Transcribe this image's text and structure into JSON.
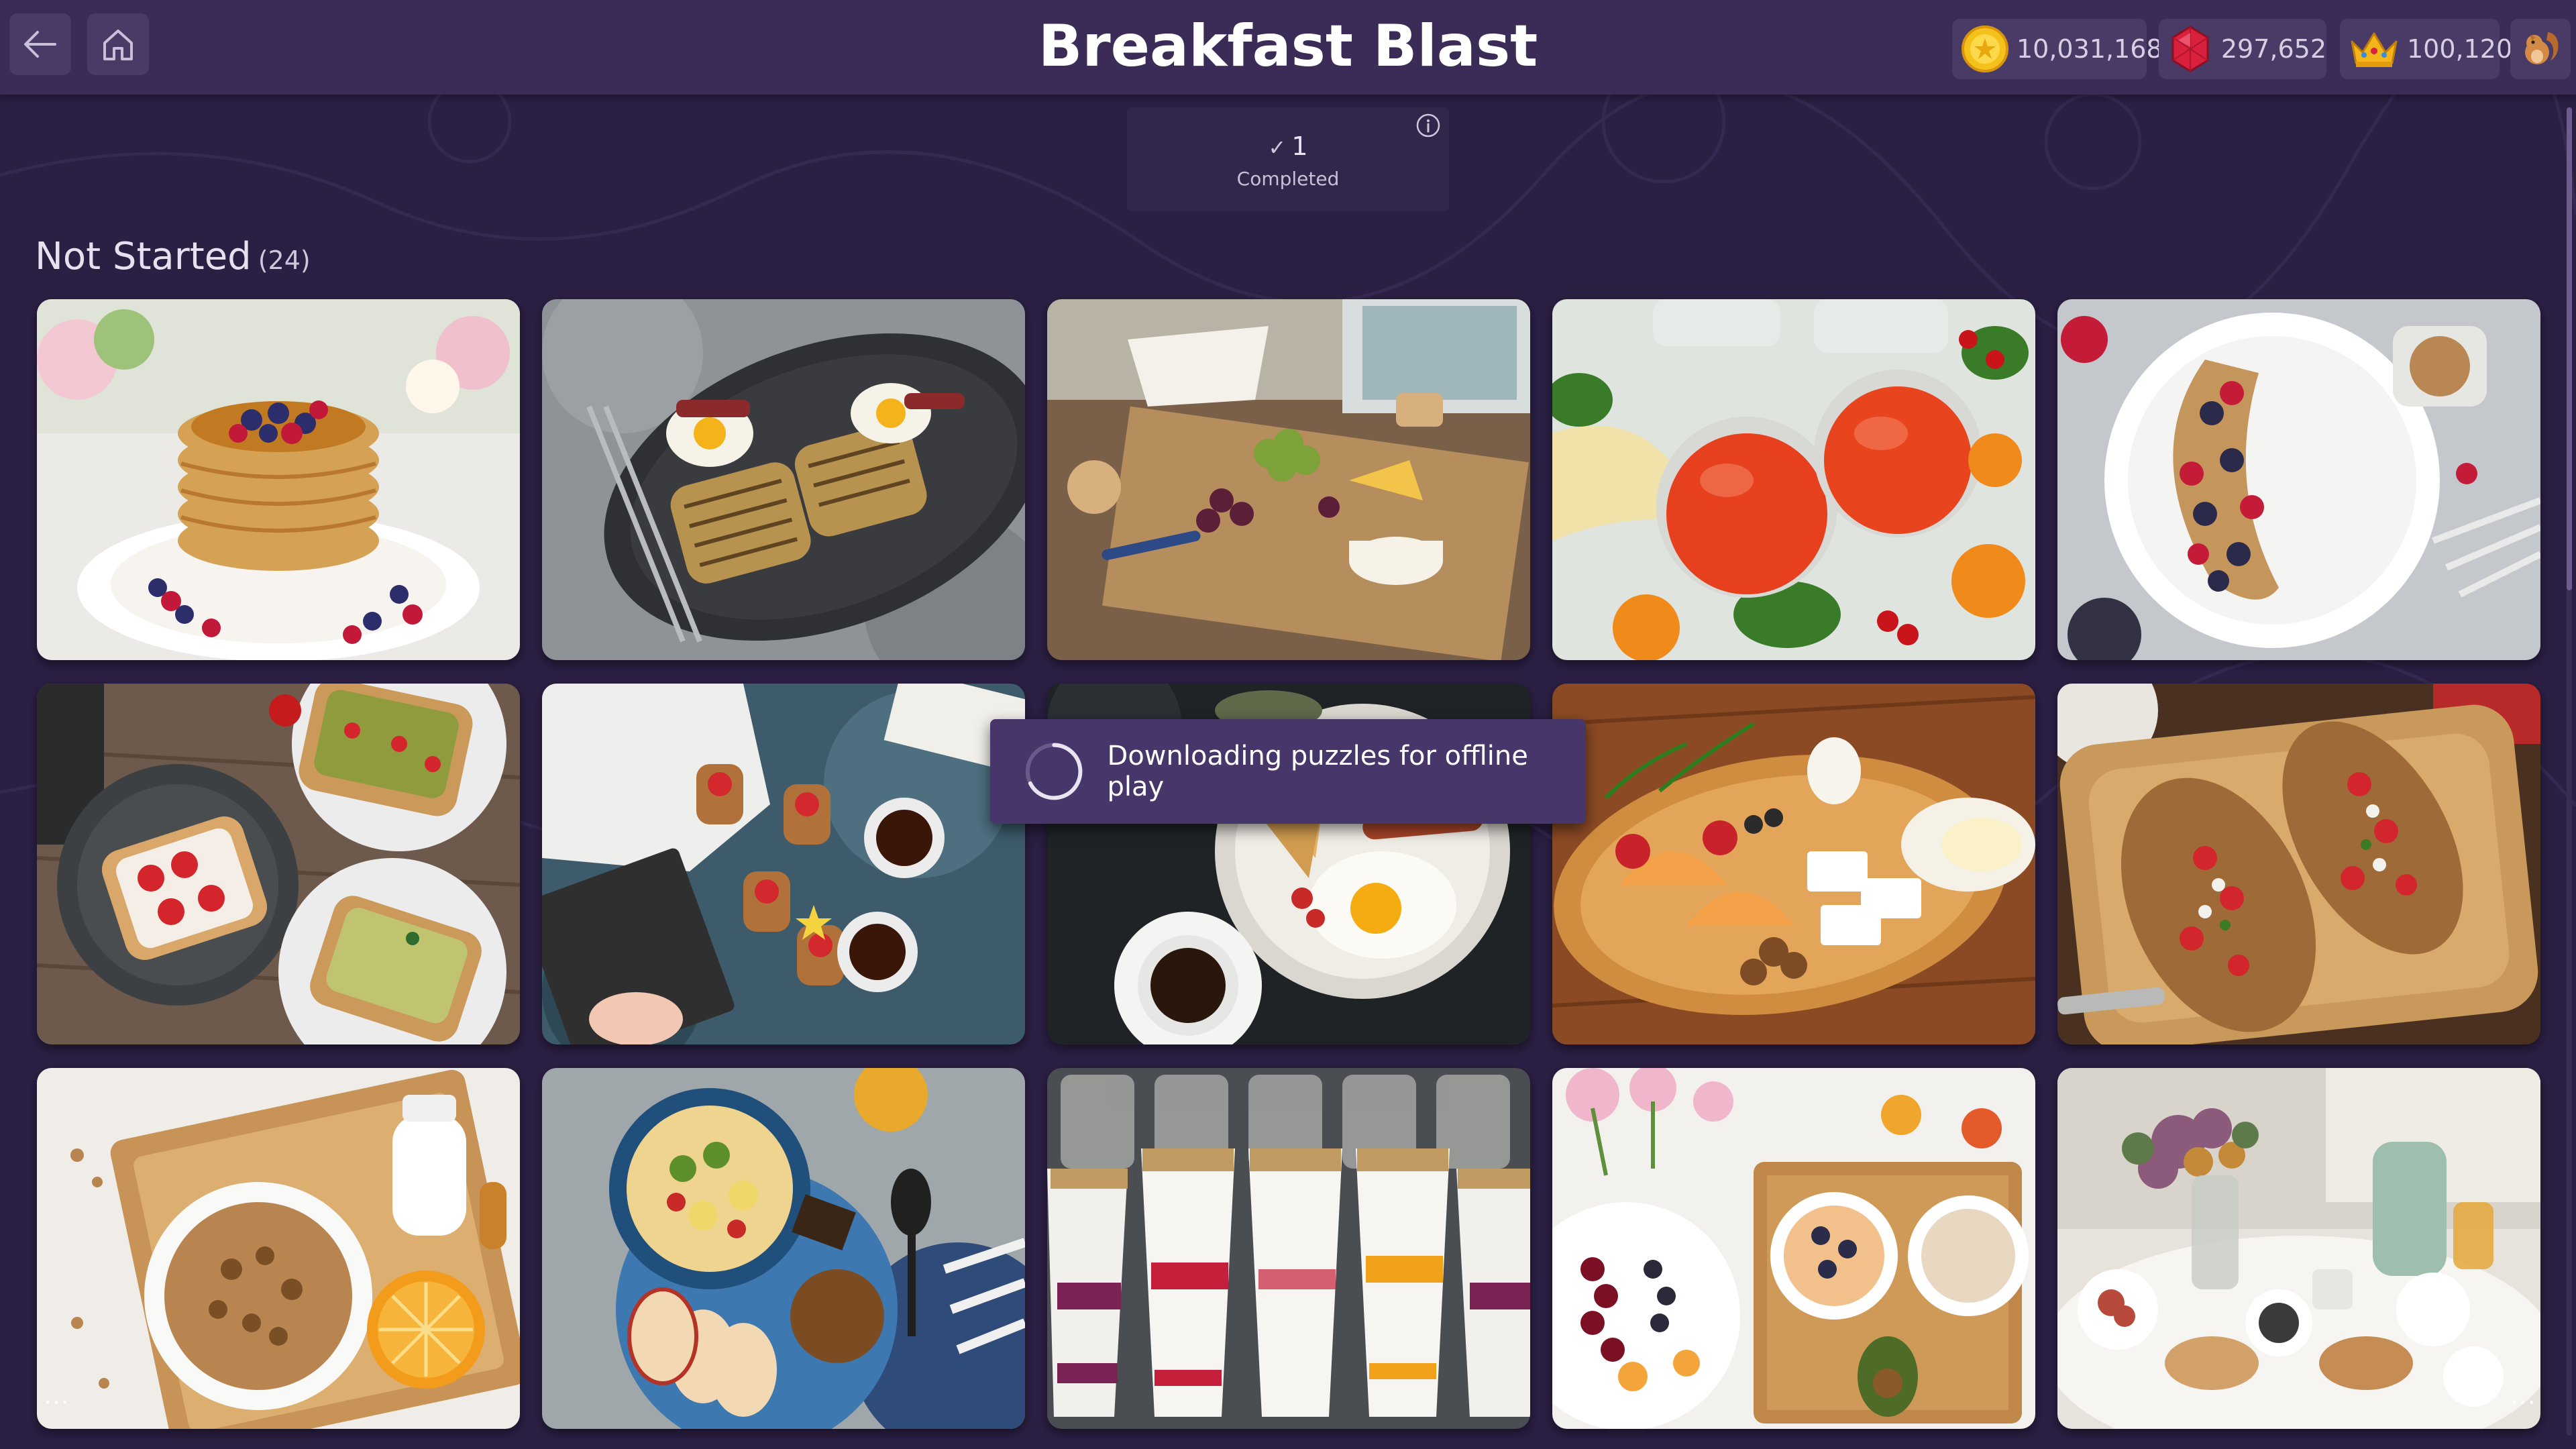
{
  "app": {
    "title": "Breakfast Blast"
  },
  "header": {
    "back_icon": "arrow-left-icon",
    "home_icon": "home-icon",
    "stats": {
      "coins": "10,031,168",
      "gems": "297,652",
      "crowns": "100,120"
    },
    "avatar_icon": "squirrel-avatar"
  },
  "progress": {
    "completed_count": "1",
    "completed_label": "Completed"
  },
  "section": {
    "title": "Not Started",
    "count": "(24)"
  },
  "toast": {
    "text": "Downloading puzzles for offline play"
  },
  "tiles": [
    "pancakes-with-berries",
    "grilled-sandwiches-eggs",
    "cheese-board-table",
    "jam-jars-apricots",
    "yogurt-berries-granola",
    "avocado-strawberry-toast",
    "breakfast-flatlay-tea",
    "eggs-bacon-coffee",
    "fruit-cheese-platter",
    "bruschetta-board",
    "cereal-milk-tray",
    "smoothie-bowl-fruit",
    "yogurt-parfait-glasses",
    "fruit-board-flowers",
    "breakfast-table-flowers"
  ],
  "colors": {
    "background": "#2b1f43",
    "header": "#3b2c57",
    "card": "#33264b",
    "toast": "#47366a",
    "coin": "#f5c21b",
    "gem": "#d9203c",
    "crown": "#f3b51b"
  }
}
